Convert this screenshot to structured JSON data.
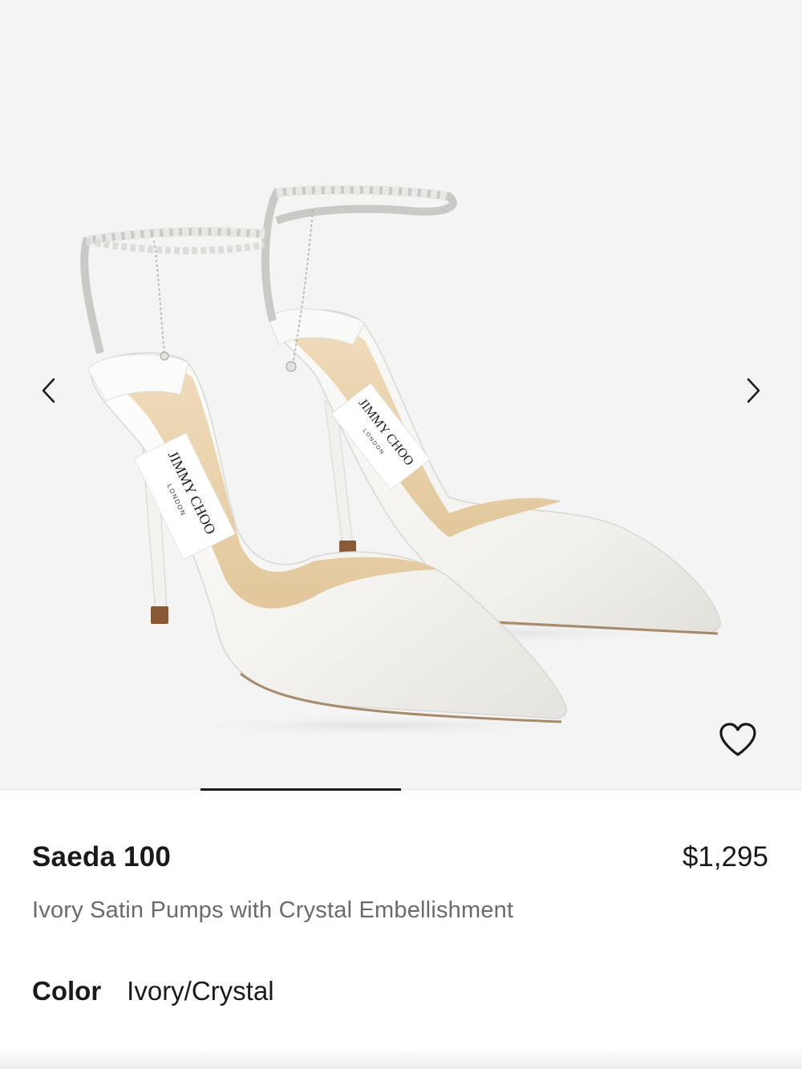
{
  "product": {
    "name": "Saeda 100",
    "price": "$1,295",
    "description": "Ivory Satin Pumps with Crystal Embellishment",
    "color_label": "Color",
    "color_value": "Ivory/Crystal",
    "brand_label": "JIMMY CHOO",
    "brand_sub": "LONDON"
  },
  "gallery": {
    "prev_icon": "chevron-left-icon",
    "next_icon": "chevron-right-icon",
    "wishlist_icon": "heart-outline-icon",
    "background": "#f4f4f4"
  },
  "colors": {
    "text": "#1a1a1a",
    "muted": "#6b6b6b",
    "satin": "#f7f6f2",
    "lining": "#e9d3ad"
  }
}
